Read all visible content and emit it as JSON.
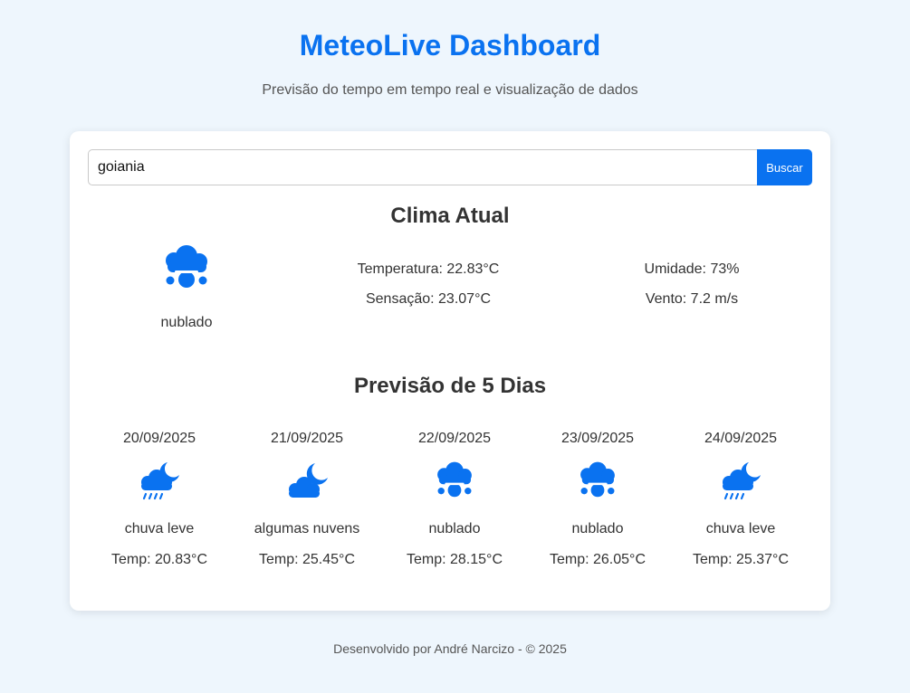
{
  "header": {
    "title": "MeteoLive Dashboard",
    "subtitle": "Previsão do tempo em tempo real e visualização de dados"
  },
  "search": {
    "value": "goiania",
    "button_label": "Buscar"
  },
  "current": {
    "title": "Clima Atual",
    "icon": "fog-cloud-icon",
    "description": "nublado",
    "temperature": "Temperatura: 22.83°C",
    "feels_like": "Sensação: 23.07°C",
    "humidity": "Umidade: 73%",
    "wind": "Vento: 7.2 m/s"
  },
  "forecast": {
    "title": "Previsão de 5 Dias",
    "days": [
      {
        "date": "20/09/2025",
        "icon": "cloud-moon-rain-icon",
        "description": "chuva leve",
        "temp": "Temp: 20.83°C"
      },
      {
        "date": "21/09/2025",
        "icon": "cloud-moon-icon",
        "description": "algumas nuvens",
        "temp": "Temp: 25.45°C"
      },
      {
        "date": "22/09/2025",
        "icon": "fog-cloud-icon",
        "description": "nublado",
        "temp": "Temp: 28.15°C"
      },
      {
        "date": "23/09/2025",
        "icon": "fog-cloud-icon",
        "description": "nublado",
        "temp": "Temp: 26.05°C"
      },
      {
        "date": "24/09/2025",
        "icon": "cloud-moon-rain-icon",
        "description": "chuva leve",
        "temp": "Temp: 25.37°C"
      }
    ]
  },
  "footer": {
    "text": "Desenvolvido por André Narcizo - © 2025"
  },
  "colors": {
    "accent": "#0a72f0",
    "background": "#eef6fd",
    "card": "#ffffff",
    "text": "#333333"
  }
}
